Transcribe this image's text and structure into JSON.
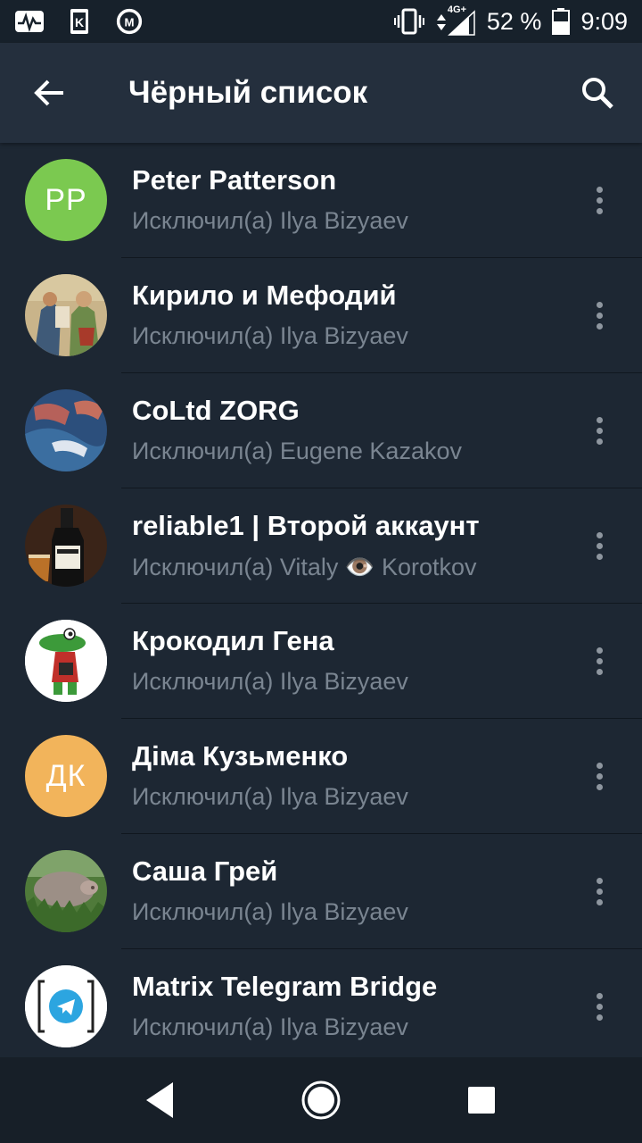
{
  "status_bar": {
    "network_label": "4G+",
    "battery_percent": "52 %",
    "time": "9:09",
    "left_icons": [
      "activity-icon",
      "k-box-icon",
      "m-circle-icon"
    ],
    "right_icons": [
      "vibrate-icon",
      "signal-icon",
      "battery-icon"
    ]
  },
  "app_bar": {
    "title": "Чёрный список",
    "back_icon": "arrow-back-icon",
    "search_icon": "search-icon"
  },
  "colors": {
    "background": "#1d2733",
    "app_bar": "#242f3d",
    "status_bar": "#17212b",
    "subtitle": "#7a8591",
    "avatar_pp": "#7bc950",
    "avatar_dk": "#f2b45b"
  },
  "list": [
    {
      "name": "Peter Patterson",
      "subtitle": "Исключил(а) Ilya Bizyaev",
      "avatar_type": "initials",
      "initials": "PP",
      "avatar_color": "#7bc950"
    },
    {
      "name": "Кирило и Мефодий",
      "subtitle": "Исключил(а) Ilya Bizyaev",
      "avatar_type": "photo",
      "photo": "saints-painting"
    },
    {
      "name": "CoLtd ZORG",
      "subtitle": "Исключил(а) Eugene Kazakov",
      "avatar_type": "photo",
      "photo": "hands-fabric"
    },
    {
      "name": "reliable1 | Второй аккаунт",
      "subtitle": "Исключил(а) Vitaly 👁️ Korotkov",
      "avatar_type": "photo",
      "photo": "whiskey-bottle"
    },
    {
      "name": "Крокодил Гена",
      "subtitle": "Исключил(а) Ilya Bizyaev",
      "avatar_type": "photo",
      "photo": "crocodile-cartoon"
    },
    {
      "name": "Діма Кузьменко",
      "subtitle": "Исключил(а) Ilya Bizyaev",
      "avatar_type": "initials",
      "initials": "ДК",
      "avatar_color": "#f2b45b"
    },
    {
      "name": "Саша Грей",
      "subtitle": "Исключил(а) Ilya Bizyaev",
      "avatar_type": "photo",
      "photo": "pig-in-grass"
    },
    {
      "name": "Matrix Telegram Bridge",
      "subtitle": "Исключил(а) Ilya Bizyaev",
      "avatar_type": "photo",
      "photo": "matrix-telegram-logo"
    }
  ],
  "nav_bar": {
    "icons": [
      "nav-back-icon",
      "nav-home-icon",
      "nav-recents-icon"
    ]
  }
}
